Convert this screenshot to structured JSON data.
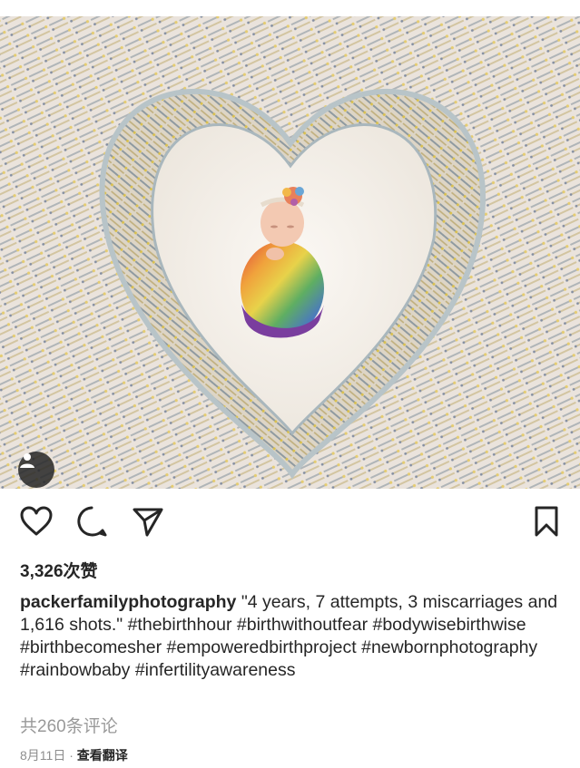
{
  "post": {
    "image_icon": "baby-heart-syringes-photo",
    "user_tag_icon": "user-tag-icon"
  },
  "actions": {
    "like_icon": "heart-icon",
    "comment_icon": "comment-icon",
    "share_icon": "send-icon",
    "save_icon": "bookmark-icon"
  },
  "likes": "3,326次赞",
  "caption": {
    "username": "packerfamilyphotography",
    "text": "\"4 years, 7 attempts, 3 miscarriages and 1,616 shots.\" #thebirthhour #birthwithoutfear #bodywisebirthwise #birthbecomesher #empoweredbirthproject #newbornphotography #rainbowbaby #infertilityawareness"
  },
  "comments": "共260条评论",
  "meta": {
    "date": "8月11日",
    "separator": " · ",
    "translate": "查看翻译"
  },
  "colors": {
    "text": "#262626",
    "muted": "#999999",
    "photo_bg": "#efe9e2"
  }
}
